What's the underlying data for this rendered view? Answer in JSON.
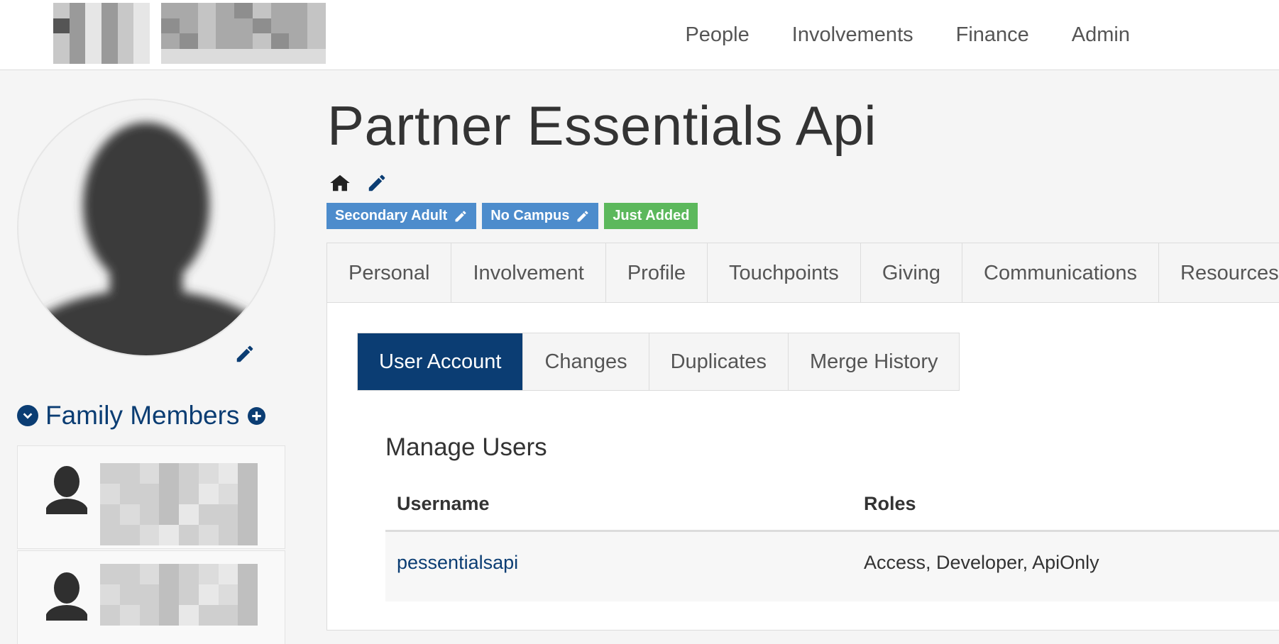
{
  "nav": {
    "items": [
      "People",
      "Involvements",
      "Finance",
      "Admin"
    ]
  },
  "person": {
    "name": "Partner Essentials Api",
    "badges": [
      {
        "label": "Secondary Adult",
        "color": "#4d8ccc",
        "editable": true
      },
      {
        "label": "No Campus",
        "color": "#4d8ccc",
        "editable": true
      },
      {
        "label": "Just Added",
        "color": "#5cb85c",
        "editable": false
      }
    ],
    "quick_icons": [
      "home-icon",
      "pencil-icon"
    ]
  },
  "family": {
    "title": "Family Members",
    "footer_text": "…"
  },
  "tabs": [
    "Personal",
    "Involvement",
    "Profile",
    "Touchpoints",
    "Giving",
    "Communications",
    "Resources"
  ],
  "subtabs": {
    "items": [
      "User Account",
      "Changes",
      "Duplicates",
      "Merge History"
    ],
    "active": "User Account"
  },
  "manage_users": {
    "title": "Manage Users",
    "columns": [
      "Username",
      "Roles"
    ],
    "rows": [
      {
        "username": "pessentialsapi",
        "roles": "Access, Developer, ApiOnly"
      }
    ]
  },
  "colors": {
    "brand": "#0b3d73",
    "badge_blue": "#4d8ccc",
    "badge_green": "#5cb85c"
  }
}
